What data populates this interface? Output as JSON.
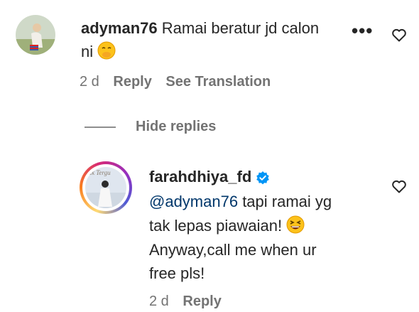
{
  "comment": {
    "username": "adyman76",
    "text_line1": "Ramai beratur jd calon",
    "text_line2": "ni",
    "time": "2 d",
    "reply_label": "Reply",
    "translate_label": "See Translation"
  },
  "replies_toggle": {
    "label": "Hide replies"
  },
  "reply": {
    "username": "farahdhiya_fd",
    "mention": "@adyman76",
    "text_line1": " tapi ramai yg",
    "text_line2": "tak lepas piawaian!",
    "text_line3": "Anyway,call me when ur",
    "text_line4": "free pls!",
    "time": "2 d",
    "reply_label": "Reply",
    "avatar_overlay_text": "Ik Tergu"
  },
  "colors": {
    "text": "#262626",
    "secondary": "#737373",
    "mention": "#00376b",
    "verified": "#0095f6"
  },
  "icons": [
    "heart-icon",
    "more-options-icon",
    "verified-badge-icon"
  ]
}
